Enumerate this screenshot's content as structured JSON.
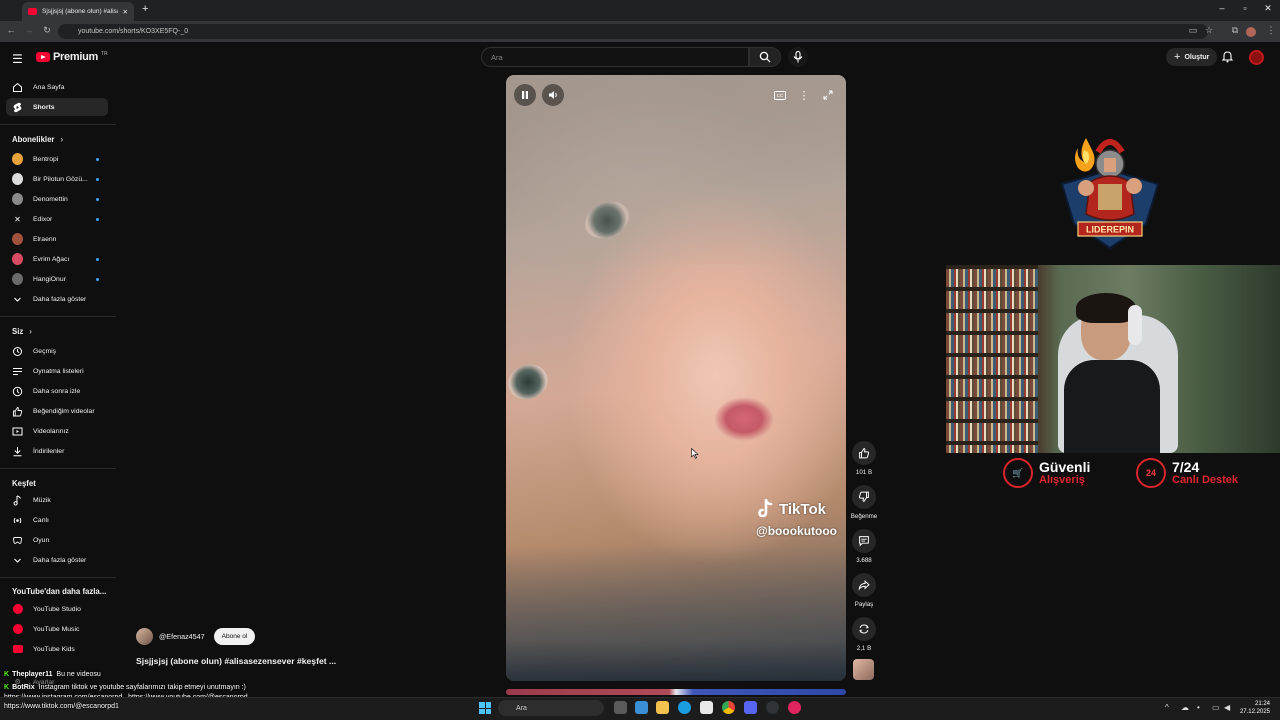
{
  "browser": {
    "tab_title": "Sjsjjsjsj (abone olun) #alisa",
    "url": "youtube.com/shorts/KO3XE5FQ-_0"
  },
  "header": {
    "brand": "Premium",
    "region": "TR",
    "search_placeholder": "Ara",
    "create_label": "Oluştur"
  },
  "sidebar": {
    "main": [
      {
        "label": "Ana Sayfa",
        "icon": "home-icon"
      },
      {
        "label": "Shorts",
        "icon": "shorts-icon",
        "active": true
      }
    ],
    "subs_heading": "Abonelikler",
    "subscriptions": [
      {
        "label": "Bentropi",
        "color": "#e8a33c"
      },
      {
        "label": "Bir Pilotun Gözü...",
        "color": "#dcdcdc"
      },
      {
        "label": "Denomettin",
        "color": "#8a8a8a"
      },
      {
        "label": "Edixor",
        "color": "#111111"
      },
      {
        "label": "Elraenn",
        "color": "#a0523d"
      },
      {
        "label": "Evrim Ağacı",
        "color": "#d84b64"
      },
      {
        "label": "HangiOnur",
        "color": "#6b6b6b"
      }
    ],
    "subs_more": "Daha fazla göster",
    "you_heading": "Siz",
    "you": [
      {
        "label": "Geçmiş",
        "icon": "history-icon"
      },
      {
        "label": "Oynatma listeleri",
        "icon": "playlist-icon"
      },
      {
        "label": "Daha sonra izle",
        "icon": "clock-icon"
      },
      {
        "label": "Beğendiğim videolar",
        "icon": "like-icon"
      },
      {
        "label": "Videolarınız",
        "icon": "video-icon"
      },
      {
        "label": "İndirilenler",
        "icon": "download-icon"
      }
    ],
    "explore_heading": "Keşfet",
    "explore": [
      {
        "label": "Müzik",
        "icon": "music-icon"
      },
      {
        "label": "Canlı",
        "icon": "live-icon"
      },
      {
        "label": "Oyun",
        "icon": "gaming-icon"
      }
    ],
    "explore_more": "Daha fazla göster",
    "more_heading": "YouTube'dan daha fazla...",
    "more": [
      {
        "label": "YouTube Studio"
      },
      {
        "label": "YouTube Music"
      },
      {
        "label": "YouTube Kids"
      }
    ],
    "settings_label": "Ayarlar"
  },
  "short": {
    "watermark_brand": "TikTok",
    "watermark_handle": "@boookutooo",
    "channel": "@Efenaz4547",
    "subscribe_label": "Abone ol",
    "title": "Sjsjjsjsj (abone olun) #alisasezensever #keşfet ...",
    "actions": [
      {
        "label": "101 B",
        "icon": "like-icon"
      },
      {
        "label": "Beğenme",
        "icon": "dislike-icon"
      },
      {
        "label": "3.688",
        "icon": "comment-icon"
      },
      {
        "label": "Paylaş",
        "icon": "share-icon"
      },
      {
        "label": "2,1 B",
        "icon": "remix-icon"
      }
    ]
  },
  "overlay": {
    "logo_text": "LIDEREPIN",
    "badge1_line1": "Güvenli",
    "badge1_line2": "Alışveriş",
    "badge2_ring": "24",
    "badge2_line1": "7/24",
    "badge2_line2": "Canlı Destek"
  },
  "chat": [
    {
      "user": "Theplayer11",
      "text": "Bu ne videosu"
    },
    {
      "user": "BotRix",
      "text": "Instagram tiktok ve youtube sayfalarımızı takip etmeyi unutmayın :)"
    },
    {
      "user": "",
      "text": "https://www.instagram.com/escanorpd_ https://www.youtube.com/@escanorpd"
    },
    {
      "user": "",
      "text": "https://www.tiktok.com/@escanorpd1"
    }
  ],
  "taskbar": {
    "search": "Ara",
    "time": "21:24",
    "date": "27.12.2025"
  }
}
